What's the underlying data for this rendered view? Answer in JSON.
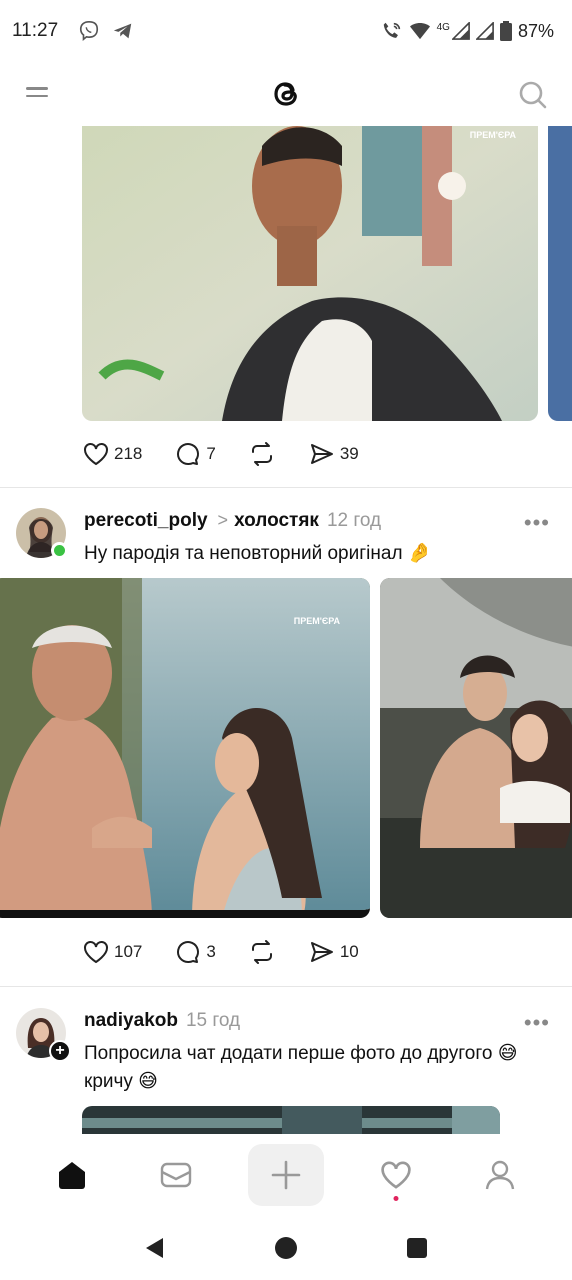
{
  "status_bar": {
    "time": "11:27",
    "network_label": "4G",
    "battery_percent": "87%",
    "icons": [
      "viber-icon",
      "telegram-icon",
      "wifi-call-icon",
      "wifi-icon",
      "signal-icon",
      "signal-icon",
      "battery-icon"
    ]
  },
  "header": {
    "menu_icon": "hamburger-menu-icon",
    "logo_icon": "threads-logo-icon",
    "search_icon": "search-icon"
  },
  "post1": {
    "likes": "218",
    "replies": "7",
    "shares": "39"
  },
  "post2": {
    "username": "perecoti_poly",
    "chevron": ">",
    "topic": "холостяк",
    "time_ago": "12 год",
    "more": "•••",
    "text": "Ну пародія та неповторний оригінал 🤌",
    "image_watermark": "ПРЕМ'ЄРА",
    "likes": "107",
    "replies": "3",
    "shares": "10"
  },
  "post3": {
    "username": "nadiyakob",
    "time_ago": "15 год",
    "more": "•••",
    "text": "Попросила чат додати перше фото до другого 😅 кричу 😅"
  },
  "post1_image_watermark": "ПРЕМ'ЄРА",
  "bottom_nav": {
    "items": [
      "home-icon",
      "inbox-icon",
      "plus-icon",
      "heart-icon",
      "profile-icon"
    ]
  },
  "colors": {
    "text": "#101010",
    "muted": "#999999",
    "accent_dot": "#e0245e",
    "online": "#3ac243"
  }
}
